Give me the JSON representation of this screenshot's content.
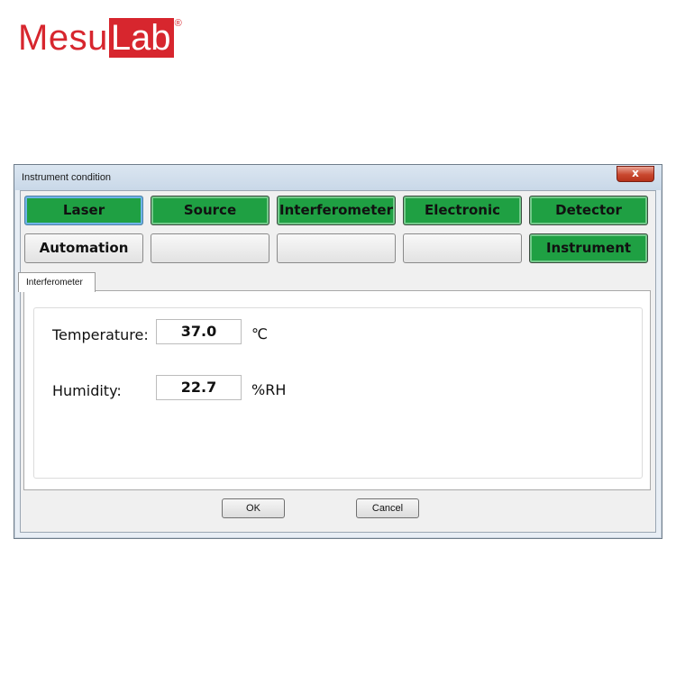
{
  "brand": {
    "prefix": "Mesu",
    "suffix": "Lab",
    "registered": "®"
  },
  "window": {
    "title": "Instrument condition",
    "close_label": "x"
  },
  "module_buttons": [
    {
      "label": "Laser",
      "state": "green",
      "focused": true
    },
    {
      "label": "Source",
      "state": "green"
    },
    {
      "label": "Interferometer",
      "state": "green"
    },
    {
      "label": "Electronic",
      "state": "green"
    },
    {
      "label": "Detector",
      "state": "green"
    },
    {
      "label": "Automation",
      "state": "default"
    },
    {
      "label": "",
      "state": "default"
    },
    {
      "label": "",
      "state": "default"
    },
    {
      "label": "",
      "state": "default"
    },
    {
      "label": "Instrument",
      "state": "green"
    }
  ],
  "tab": {
    "label": "Interferometer"
  },
  "fields": {
    "temperature": {
      "label": "Temperature:",
      "value": "37.0",
      "unit": "℃"
    },
    "humidity": {
      "label": "Humidity:",
      "value": "22.7",
      "unit": "%RH"
    }
  },
  "dialog_buttons": {
    "ok": "OK",
    "cancel": "Cancel"
  },
  "colors": {
    "brand_red": "#d7262e",
    "status_green": "#1fa043"
  }
}
